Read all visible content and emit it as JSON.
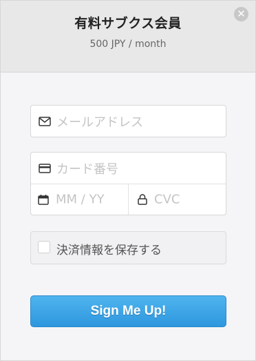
{
  "header": {
    "title": "有料サブクス会員",
    "subtitle": "500 JPY / month",
    "close_icon": "close-icon"
  },
  "form": {
    "email": {
      "placeholder": "メールアドレス",
      "value": "",
      "icon": "envelope-icon"
    },
    "card_number": {
      "placeholder": "カード番号",
      "value": "",
      "icon": "credit-card-icon"
    },
    "expiry": {
      "placeholder": "MM / YY",
      "value": "",
      "icon": "calendar-icon"
    },
    "cvc": {
      "placeholder": "CVC",
      "value": "",
      "icon": "lock-icon"
    },
    "remember": {
      "label": "決済情報を保存する",
      "checked": false
    }
  },
  "submit": {
    "label": "Sign Me Up!"
  },
  "colors": {
    "accent": "#3aa3e6",
    "header_bg": "#e8e8e8",
    "body_bg": "#f5f5f7",
    "placeholder": "#c4c4c4"
  }
}
